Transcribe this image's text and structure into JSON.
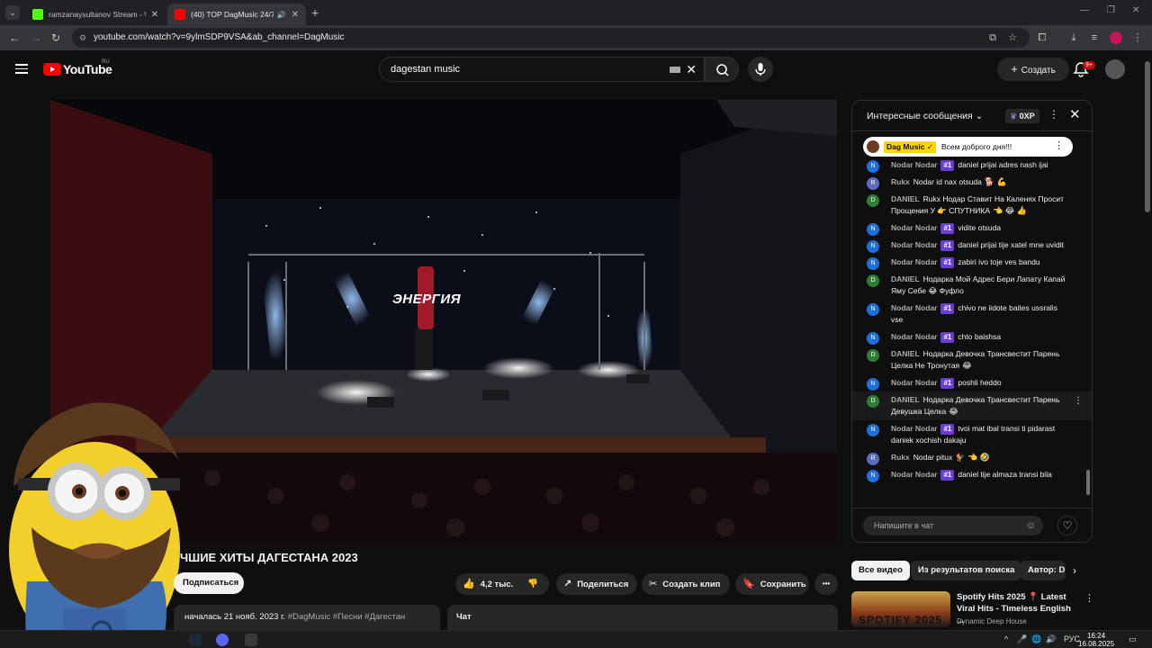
{
  "browser": {
    "tabs": [
      {
        "title": "ramzanaysultanov Stream - Wa",
        "close": "✕"
      },
      {
        "title": "(40) TOP DagMusic 24/7 Л",
        "close": "✕"
      }
    ],
    "url": "youtube.com/watch?v=9ylmSDP9VSA&ab_channel=DagMusic"
  },
  "header": {
    "logo_text": "YouTube",
    "country": "RU",
    "search_value": "dagestan music",
    "create_label": "Создать",
    "notif_count": "9+"
  },
  "video": {
    "stage_text": "ЭНЕРГИЯ",
    "title": "ЧШИЕ ХИТЫ ДАГЕСТАНА 2023",
    "subscribe_label": "Подписаться",
    "likes": "4,2 тыс.",
    "share_label": "Поделиться",
    "clip_label": "Создать клип",
    "save_label": "Сохранить",
    "more_label": "•••",
    "started": "началась 21 нояб. 2023 г.",
    "tags": "#DagMusic #Песни #Дагестан",
    "chat_label": "Чат"
  },
  "chat": {
    "title": "Интересные сообщения",
    "xp": "0XP",
    "pinned_author": "Dag Music ✓",
    "pinned_text": "Всем доброго дня!!!",
    "input_placeholder": "Напишите в чат",
    "messages": [
      {
        "initial": "N",
        "color": "#1e6fd9",
        "author": "Nodar Nodar",
        "badge": "#1",
        "text": "daniel prijai adres nash ijai",
        "emoji": ""
      },
      {
        "initial": "R",
        "color": "#5c6bc0",
        "author": "Rukx",
        "badge": "",
        "text": "Nodar id nax otsuda",
        "emoji": "🐕 💪"
      },
      {
        "initial": "D",
        "color": "#2e7d32",
        "author": "DANIEL",
        "badge": "",
        "text": "Rukx Нодар Ставит На Каленях Просит Прощения У 👉 СПУТНИКА",
        "emoji": "👈 😂 👍"
      },
      {
        "initial": "N",
        "color": "#1e6fd9",
        "author": "Nodar Nodar",
        "badge": "#1",
        "text": "vidite otsuda",
        "emoji": ""
      },
      {
        "initial": "N",
        "color": "#1e6fd9",
        "author": "Nodar Nodar",
        "badge": "#1",
        "text": "daniel prijai tije xatel mne uvidit",
        "emoji": ""
      },
      {
        "initial": "N",
        "color": "#1e6fd9",
        "author": "Nodar Nodar",
        "badge": "#1",
        "text": "zabiri ivo toje ves bandu",
        "emoji": ""
      },
      {
        "initial": "D",
        "color": "#2e7d32",
        "author": "DANIEL",
        "badge": "",
        "text": "Нодарка Мой Адрес Бери Лапату Капай Яму Себе 😂 Фуфло",
        "emoji": ""
      },
      {
        "initial": "N",
        "color": "#1e6fd9",
        "author": "Nodar Nodar",
        "badge": "#1",
        "text": "chivo ne iidote baites ussralis vse",
        "emoji": ""
      },
      {
        "initial": "N",
        "color": "#1e6fd9",
        "author": "Nodar Nodar",
        "badge": "#1",
        "text": "chto baishsa",
        "emoji": ""
      },
      {
        "initial": "D",
        "color": "#2e7d32",
        "author": "DANIEL",
        "badge": "",
        "text": "Нодарка Девочка Трансвестит Парень Целка Не Тронутая",
        "emoji": "😂"
      },
      {
        "initial": "N",
        "color": "#1e6fd9",
        "author": "Nodar Nodar",
        "badge": "#1",
        "text": "poshli heddo",
        "emoji": ""
      },
      {
        "initial": "D",
        "color": "#2e7d32",
        "author": "DANIEL",
        "badge": "",
        "text": "Нодарка Девочка Трансвестит Парень Девушка Целка",
        "emoji": "😂",
        "highlight": true
      },
      {
        "initial": "N",
        "color": "#1e6fd9",
        "author": "Nodar Nodar",
        "badge": "#1",
        "text": "tvoi mat ibal transi ti pidarast daniek xochish dakaju",
        "emoji": ""
      },
      {
        "initial": "R",
        "color": "#5c6bc0",
        "author": "Rukx",
        "badge": "",
        "text": "Nodar pitux",
        "emoji": "🐓 👈 🤣"
      },
      {
        "initial": "N",
        "color": "#1e6fd9",
        "author": "Nodar Nodar",
        "badge": "#1",
        "text": "daniel tije almaza transi bila",
        "emoji": ""
      }
    ]
  },
  "recommendations": {
    "chips": [
      "Все видео",
      "Из результатов поиска",
      "Автор: D"
    ],
    "item": {
      "title": "Spotify Hits 2025 📍 Latest Viral Hits - Timeless English ...",
      "channel": "Dynamic Deep House",
      "thumb_text": "SPOTIFY 2025"
    }
  },
  "taskbar": {
    "lang": "РУС",
    "time": "16:24",
    "date": "16.08.2025"
  }
}
